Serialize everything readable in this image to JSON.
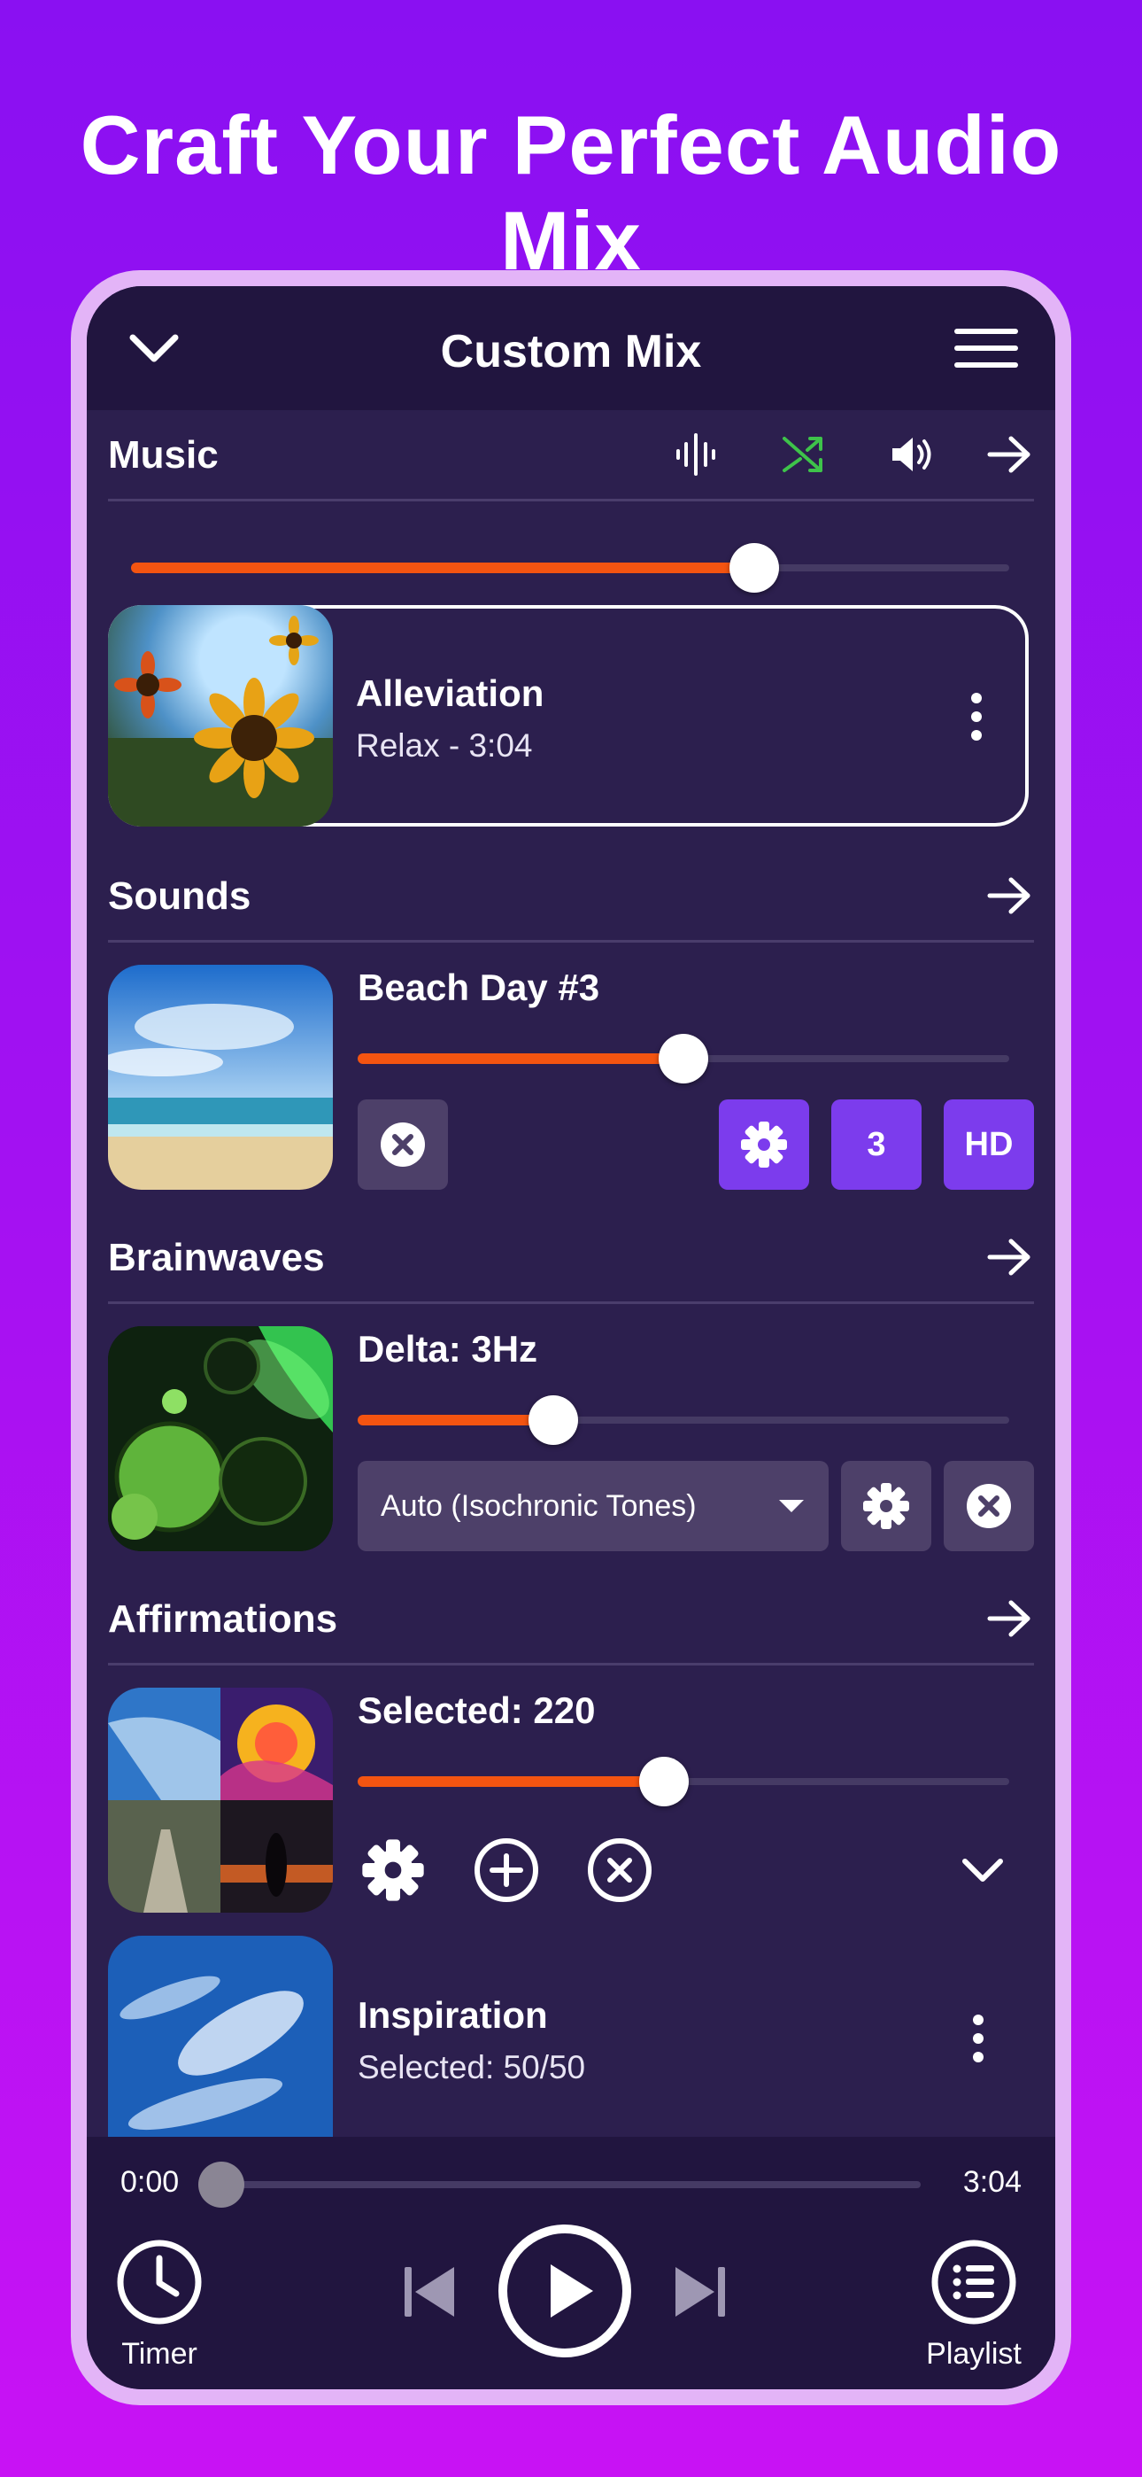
{
  "headline": "Craft Your Perfect Audio Mix",
  "topbar": {
    "title": "Custom Mix",
    "left_icon": "chevron-down-icon",
    "right_icon": "menu-icon"
  },
  "music": {
    "label": "Music",
    "icons": [
      "waveform-icon",
      "shuffle-icon",
      "volume-icon",
      "arrow-right-icon"
    ],
    "shuffle_color": "#3ec34a",
    "volume": 0.71,
    "track": {
      "title": "Alleviation",
      "subtitle": "Relax - 3:04"
    }
  },
  "sounds": {
    "label": "Sounds",
    "item": {
      "title": "Beach Day #3",
      "volume": 0.5,
      "count_label": "3",
      "quality_label": "HD"
    }
  },
  "brainwaves": {
    "label": "Brainwaves",
    "item": {
      "title": "Delta: 3Hz",
      "volume": 0.3,
      "mode": "Auto (Isochronic Tones)"
    }
  },
  "affirmations": {
    "label": "Affirmations",
    "item": {
      "title": "Selected: 220",
      "volume": 0.47
    },
    "sub_item": {
      "title": "Inspiration",
      "subtitle": "Selected: 50/50"
    }
  },
  "player": {
    "elapsed": "0:00",
    "duration": "3:04",
    "progress": 0.0,
    "timer_label": "Timer",
    "playlist_label": "Playlist"
  },
  "colors": {
    "accent": "#f45411",
    "purple_button": "#7c3ced",
    "background_panel": "#2c1f4e"
  }
}
